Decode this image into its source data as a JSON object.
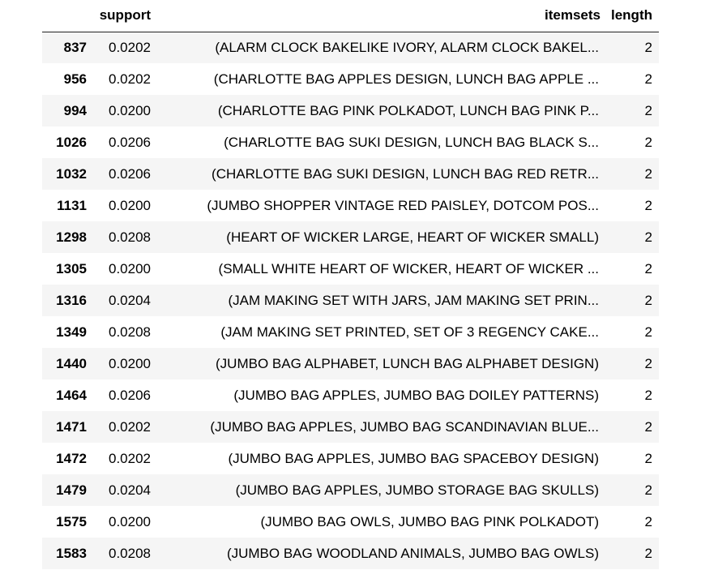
{
  "table": {
    "columns": {
      "index": "",
      "support": "support",
      "itemsets": "itemsets",
      "length": "length"
    },
    "rows": [
      {
        "index": "837",
        "support": "0.0202",
        "itemsets": "(ALARM CLOCK BAKELIKE IVORY, ALARM CLOCK BAKEL...",
        "length": "2"
      },
      {
        "index": "956",
        "support": "0.0202",
        "itemsets": "(CHARLOTTE BAG APPLES DESIGN, LUNCH BAG APPLE ...",
        "length": "2"
      },
      {
        "index": "994",
        "support": "0.0200",
        "itemsets": "(CHARLOTTE BAG PINK POLKADOT, LUNCH BAG PINK P...",
        "length": "2"
      },
      {
        "index": "1026",
        "support": "0.0206",
        "itemsets": "(CHARLOTTE BAG SUKI DESIGN, LUNCH BAG BLACK S...",
        "length": "2"
      },
      {
        "index": "1032",
        "support": "0.0206",
        "itemsets": "(CHARLOTTE BAG SUKI DESIGN, LUNCH BAG RED RETR...",
        "length": "2"
      },
      {
        "index": "1131",
        "support": "0.0200",
        "itemsets": "(JUMBO SHOPPER VINTAGE RED PAISLEY, DOTCOM POS...",
        "length": "2"
      },
      {
        "index": "1298",
        "support": "0.0208",
        "itemsets": "(HEART OF WICKER LARGE, HEART OF WICKER SMALL)",
        "length": "2"
      },
      {
        "index": "1305",
        "support": "0.0200",
        "itemsets": "(SMALL WHITE HEART OF WICKER, HEART OF WICKER ...",
        "length": "2"
      },
      {
        "index": "1316",
        "support": "0.0204",
        "itemsets": "(JAM MAKING SET WITH JARS, JAM MAKING SET PRIN...",
        "length": "2"
      },
      {
        "index": "1349",
        "support": "0.0208",
        "itemsets": "(JAM MAKING SET PRINTED, SET OF 3 REGENCY CAKE...",
        "length": "2"
      },
      {
        "index": "1440",
        "support": "0.0200",
        "itemsets": "(JUMBO BAG ALPHABET, LUNCH BAG ALPHABET DESIGN)",
        "length": "2"
      },
      {
        "index": "1464",
        "support": "0.0206",
        "itemsets": "(JUMBO BAG APPLES, JUMBO BAG DOILEY PATTERNS)",
        "length": "2"
      },
      {
        "index": "1471",
        "support": "0.0202",
        "itemsets": "(JUMBO BAG APPLES, JUMBO BAG SCANDINAVIAN BLUE...",
        "length": "2"
      },
      {
        "index": "1472",
        "support": "0.0202",
        "itemsets": "(JUMBO BAG APPLES, JUMBO BAG SPACEBOY DESIGN)",
        "length": "2"
      },
      {
        "index": "1479",
        "support": "0.0204",
        "itemsets": "(JUMBO BAG APPLES, JUMBO STORAGE BAG SKULLS)",
        "length": "2"
      },
      {
        "index": "1575",
        "support": "0.0200",
        "itemsets": "(JUMBO BAG OWLS, JUMBO BAG PINK POLKADOT)",
        "length": "2"
      },
      {
        "index": "1583",
        "support": "0.0208",
        "itemsets": "(JUMBO BAG WOODLAND ANIMALS, JUMBO BAG OWLS)",
        "length": "2"
      }
    ]
  }
}
